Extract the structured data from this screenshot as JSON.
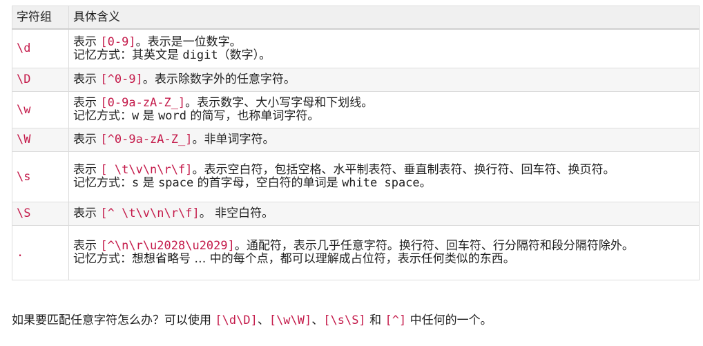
{
  "table": {
    "header": {
      "col1": "字符组",
      "col2": "具体含义"
    },
    "rows": [
      {
        "symbol": "\\d",
        "l1_pre": "表示 ",
        "l1_code": "[0-9]",
        "l1_post": "。表示是一位数字。",
        "l2_pre": "记忆方式：其英文是 ",
        "l2_code": "digit",
        "l2_post": "（数字）。"
      },
      {
        "symbol": "\\D",
        "l1_pre": "表示 ",
        "l1_code": "[^0-9]",
        "l1_post": "。表示除数字外的任意字符。"
      },
      {
        "symbol": "\\w",
        "l1_pre": "表示 ",
        "l1_code": "[0-9a-zA-Z_]",
        "l1_post": "。表示数字、大小写字母和下划线。",
        "l2_pre": "记忆方式：",
        "l2_code": "w",
        "l2_mid": " 是 ",
        "l2_code2": "word",
        "l2_post": " 的简写，也称单词字符。"
      },
      {
        "symbol": "\\W",
        "l1_pre": "表示 ",
        "l1_code": "[^0-9a-zA-Z_]",
        "l1_post": "。非单词字符。"
      },
      {
        "symbol": "\\s",
        "l1_pre": "表示 ",
        "l1_code": "[ \\t\\v\\n\\r\\f]",
        "l1_post": "。表示空白符，包括空格、水平制表符、垂直制表符、换行符、回车符、换页符。",
        "l2_pre": "记忆方式：",
        "l2_code": "s",
        "l2_mid": " 是 ",
        "l2_code2": "space",
        "l2_mid2": " 的首字母，空白符的单词是 ",
        "l2_code3": "white space",
        "l2_post": "。"
      },
      {
        "symbol": "\\S",
        "l1_pre": "表示 ",
        "l1_code": "[^ \\t\\v\\n\\r\\f]",
        "l1_post": "。 非空白符。"
      },
      {
        "symbol": ".",
        "l1_pre": "表示 ",
        "l1_code": "[^\\n\\r\\u2028\\u2029]",
        "l1_post": "。通配符，表示几乎任意字符。换行符、回车符、行分隔符和段分隔符除外。",
        "l2_pre": "记忆方式：想想省略号 … 中的每个点，都可以理解成占位符，表示任何类似的东西。"
      }
    ]
  },
  "footer": {
    "pre": "如果要匹配任意字符怎么办？可以使用 ",
    "code1": "[\\d\\D]",
    "sep1": "、",
    "code2": "[\\w\\W]",
    "sep2": "、",
    "code3": "[\\s\\S]",
    "and": " 和 ",
    "code4": "[^]",
    "post": " 中任何的一个。"
  }
}
